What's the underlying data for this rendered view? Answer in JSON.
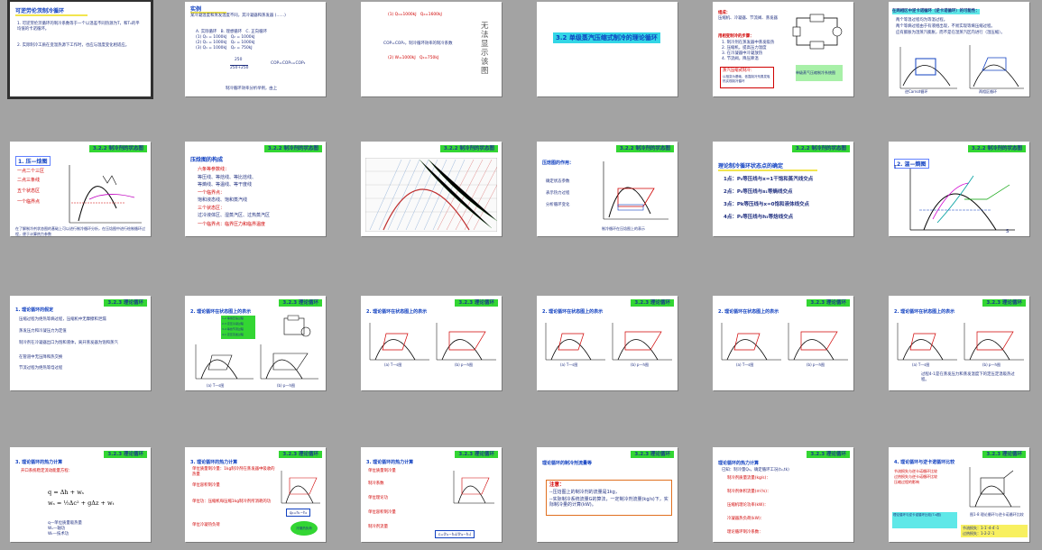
{
  "s1": {
    "title": "可逆劳伦茨制冷循环",
    "lines": [
      "1. 可逆劳伦茨循环的制冷系数等于一个以温差不同热源为T，和T₀的平均值的卡诺循环。",
      "2. 实际制冷工质在变温热源下工作时，也应与温度变化相适应。"
    ]
  },
  "s2": {
    "title": "实例",
    "lines": [
      "某冷凝温度和蒸发温度不同，其冷凝器和蒸发器 (……)",
      "A. 实际循环　B. 理想循环　C. 正向循环",
      "(1) Q₁ = 1000kJ　Q₂ = 1000kJ",
      "(2) Q₁ = 1000kJ　Q₂ = 1000kJ",
      "(3) Q₁ = 1000kJ　Q₂ = 750kJ"
    ],
    "eq1": "250",
    "eq2": "250+250",
    "eq3": "COP=COP₁=COP₂",
    "foot": "制冷循环效率分析举例，由上"
  },
  "s3": {
    "v1": "(1) Q₁=1000kJ　Q₂=1600kJ",
    "v2": "(2) W=1000kJ　Q₂=750kJ",
    "cop": "COP=COP₂，制冷循环效率的制冷系数",
    "vtext": "无法显示该图"
  },
  "s4": {
    "title": "3.2 单级蒸汽压缩式制冷的理论循环"
  },
  "s5": {
    "h1": "组成：",
    "h1v": "压缩机、冷凝器、节流阀、蒸发器",
    "h2": "用相变制冷的步骤：",
    "steps": [
      "1. 制冷剂在蒸发器中蒸发吸热",
      "2. 压缩机，提高压力温度",
      "3. 在冷凝器中冷凝放热",
      "4. 节流阀，降压降温"
    ],
    "box": "蒸汽压缩式制冷：",
    "box2": "以相变为基础，依靠制冷剂蒸发吸热实现制冷循环",
    "cap": "单级蒸气压缩制冷系统图"
  },
  "s6": {
    "title": "在两相区中逆卡诺循环（逆卡诺循环）的可能性：",
    "l1": "两个等温过程均为等温过程。",
    "l2": "两个等熵过程由于有液相出现，不易实现等熵压缩过程。",
    "l3": "应有膨胀为湿蒸汽膨胀，而不是在湿蒸汽区内进行（湿压缩）。",
    "cap": "逆Carnot循环",
    "cap2": "两相区循环"
  },
  "s7": {
    "banner": "3.2.2 制冷剂的状态图",
    "title": "1. 压—焓图",
    "items": [
      "一点二个三区",
      "二点三条线",
      "五个状态区",
      "一个临界点"
    ],
    "foot": "在了解制冷剂状态图的基础上可以进行制冷循环分析，在压焓图中进行绘制循环过程，便于计算热力参数"
  },
  "s8": {
    "banner": "3.2.2 制冷剂的状态图",
    "title": "压焓图的构成",
    "items": [
      "六条等参数线：",
      "等压线、等焓线、等比焓线、",
      "等熵线、等温线、等干度线",
      "一个临界点：",
      "饱和液态线、饱和蒸汽线",
      "三个状态区：",
      "过冷液体区、湿蒸汽区、过热蒸汽区",
      "一个临界点：临界压力和临界温度"
    ]
  },
  "s9": {
    "banner": "3.2.2 制冷剂的状态图"
  },
  "s10": {
    "banner": "3.2.2 制冷剂的状态图",
    "title": "压焓图的作用：",
    "items": [
      "确定状态参数",
      "表示热力过程",
      "分析循环变化"
    ],
    "cap": "制冷循环在压焓图上的表示"
  },
  "s11": {
    "banner": "3.2.2 制冷剂的状态图",
    "title": "理论制冷循环状态点的确定",
    "items": [
      "1点：P₀等压线与x=1干饱和蒸汽线交点",
      "2点：P₀等压线与s₁等熵线交点",
      "3点：Pk等压线与x=0饱和液体线交点",
      "4点：P₀等压线与h₃等焓线交点"
    ]
  },
  "s12": {
    "banner": "3.2.2 制冷剂的状态图",
    "title": "2. 温—熵图",
    "T": "T",
    "S": "S"
  },
  "s13": {
    "banner": "3.2.3 理论循环",
    "title": "1. 理论循环的假定",
    "items": [
      "压缩过程为绝热等熵过程，压缩机中无摩擦和泄漏",
      "蒸发压力和冷凝压力为定值",
      "制冷剂在冷凝器出口为饱和液体，离开蒸发器为饱和蒸汽",
      "在管道中无压降和热交换",
      "节流过程为绝热等焓过程"
    ]
  },
  "s14": {
    "banner": "3.2.3 理论循环",
    "title": "2. 理论循环在状态图上的表示",
    "legend": [
      "1-2 等熵压缩过程",
      "2-3 定压冷凝过程",
      "3-4 等焓节流过程",
      "4-1 定压蒸发过程"
    ],
    "capa": "(a) T—s图",
    "capb": "(b) p—h图"
  },
  "s15": {
    "banner": "3.2.3 理论循环",
    "title": "2. 理论循环在状态图上的表示",
    "capa": "(a) T—s图",
    "capb": "(b) p—h图"
  },
  "s16": {
    "banner": "3.2.3 理论循环",
    "title": "2. 理论循环在状态图上的表示",
    "capa": "(a) T—s图",
    "capb": "(b) p—h图"
  },
  "s17": {
    "banner": "3.2.3 理论循环",
    "title": "2. 理论循环在状态图上的表示",
    "capa": "(a) T—s图",
    "capb": "(b) p—h图"
  },
  "s18": {
    "banner": "3.2.3 理论循环",
    "title": "2. 理论循环在状态图上的表示",
    "capa": "(a) T—s图",
    "capb": "(b) p—h图",
    "foot": "过程4-1是在蒸发压力和蒸发温度下的定压定温吸热过程。"
  },
  "s19": {
    "banner": "3.2.3 理论循环",
    "title": "3. 理论循环的热力计算",
    "red": "开口系统稳定流动能量方程：",
    "eq1": "q = Δh + wₛ",
    "eq2": "wₛ = ½Δc² + gΔz + wₜ",
    "legend": [
      "q—单位质量吸热量",
      "Wₛ—轴功",
      "Wₜ—技术功"
    ]
  },
  "s20": {
    "banner": "3.2.3 理论循环",
    "title": "3. 理论循环的热力计算",
    "items": [
      "单位质量制冷量：1kg制冷剂在蒸发器中吸收的热量",
      "单位容积制冷量",
      "单位功：压缩机每压缩1kg制冷剂所消耗的功",
      "单位冷凝热负荷"
    ],
    "badge": "冷凝热负荷",
    "tag": "q₀=h₁−h₄"
  },
  "s21": {
    "banner": "3.2.3 理论循环",
    "title": "3. 理论循环的热力计算",
    "items": [
      "单位质量制冷量",
      "制冷系数",
      "单位理论功",
      "单位容积制冷量",
      "制冷剂流量"
    ],
    "tag": "ε=(h₁−h₄)/(h₂−h₁)"
  },
  "s22": {
    "banner": "3.2.3 理论循环",
    "title": "理论循环的制冷剂流量等",
    "box1": "注意：",
    "box2": "--压焓图上的制冷剂的流量是1kg，",
    "box3": "--实际制冷系统流量G的算法，一定制冷剂流量(kg/s)下，实际制冷量的计算(kW)。"
  },
  "s23": {
    "banner": "3.2.3 理论循环",
    "title": "理论循环的热力计算",
    "intro": "已知：制冷量Q₀，确定循环工况(t₀,tk)",
    "items": [
      "制冷剂质量流量(kg/s)：",
      "制冷剂体积流量(m³/s)：",
      "压缩机理论功率(kW)：",
      "冷凝器热负荷(kW)：",
      "理论循环制冷系数："
    ]
  },
  "s24": {
    "banner": "3.2.3 理论循环",
    "title": "4. 理论循环与逆卡诺循环比较",
    "items": [
      "节流损失与逆卡诺循环比较",
      "过热损失与逆卡诺循环比较",
      "压缩过程的影响"
    ],
    "b1": "理论循环与逆卡诺循环比较(T-s图)",
    "cap": "图1-8 理论循环与逆卡诺循环比较",
    "f1": "节流损失：1-1′-4-4′-1",
    "f2": "过热损失：1-2-2′-1"
  }
}
